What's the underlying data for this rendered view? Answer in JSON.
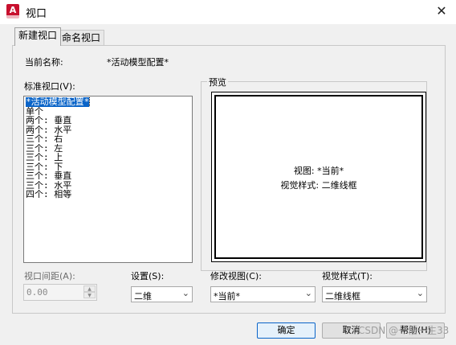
{
  "window": {
    "app_icon_letter": "A",
    "title": "视口",
    "close_glyph": "✕"
  },
  "tabs": [
    {
      "label": "新建视口",
      "active": true
    },
    {
      "label": "命名视口",
      "active": false
    }
  ],
  "current_name": {
    "label": "当前名称:",
    "value": "*活动模型配置*"
  },
  "standard_viewports": {
    "label": "标准视口(V):",
    "items": [
      "*活动模型配置*",
      "单个",
      "两个: 垂直",
      "两个: 水平",
      "三个: 右",
      "三个: 左",
      "三个: 上",
      "三个: 下",
      "三个: 垂直",
      "三个: 水平",
      "四个: 相等"
    ],
    "selected_index": 0
  },
  "preview": {
    "label": "预览",
    "view_line": "视图: *当前*",
    "style_line": "视觉样式: 二维线框"
  },
  "viewport_spacing": {
    "label": "视口间距(A):",
    "value": "0.00"
  },
  "setup": {
    "label": "设置(S):",
    "value": "二维"
  },
  "change_view": {
    "label": "修改视图(C):",
    "value": "*当前*"
  },
  "visual_style": {
    "label": "视觉样式(T):",
    "value": "二维线框"
  },
  "buttons": {
    "ok": "确定",
    "cancel": "取消",
    "help": "帮助(H)"
  },
  "watermark": "CSDN @一悟一生33"
}
